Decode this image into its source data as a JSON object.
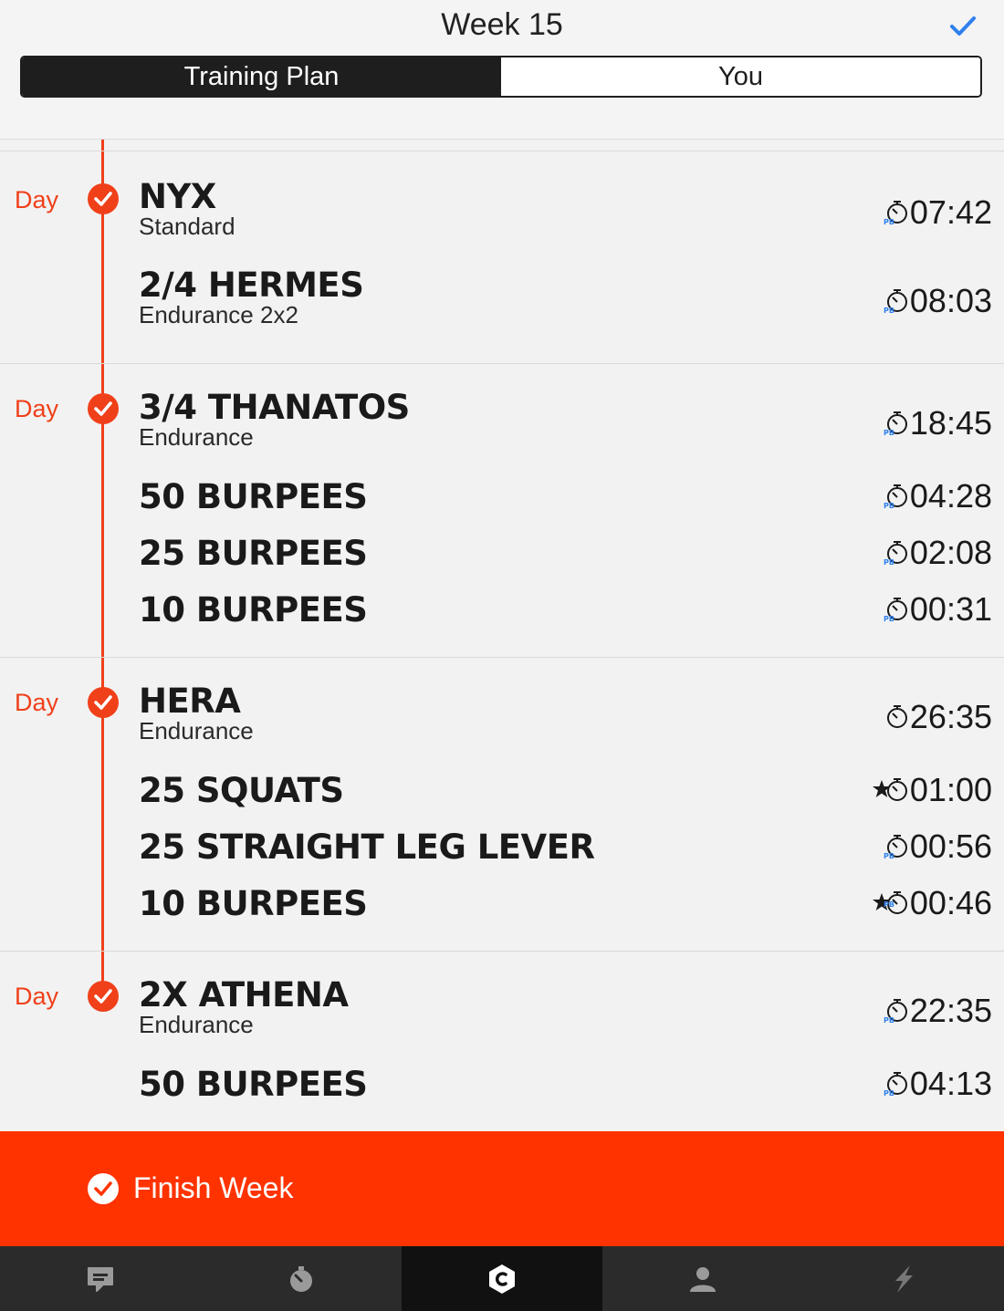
{
  "header": {
    "title": "Week 15",
    "segments": {
      "plan": "Training Plan",
      "you": "You"
    }
  },
  "days": [
    {
      "label": "Day",
      "workouts": [
        {
          "name": "NYX",
          "subtitle": "Standard",
          "time": "07:42",
          "icon": "stopwatch-pb-icon"
        },
        {
          "name": "2/4 HERMES",
          "subtitle": "Endurance 2x2",
          "time": "08:03",
          "icon": "stopwatch-pb-icon"
        }
      ]
    },
    {
      "label": "Day",
      "workouts": [
        {
          "name": "3/4 THANATOS",
          "subtitle": "Endurance",
          "time": "18:45",
          "icon": "stopwatch-pb-icon"
        },
        {
          "name": "50 BURPEES",
          "time": "04:28",
          "icon": "stopwatch-pb-icon"
        },
        {
          "name": "25 BURPEES",
          "time": "02:08",
          "icon": "stopwatch-pb-icon"
        },
        {
          "name": "10 BURPEES",
          "time": "00:31",
          "icon": "stopwatch-pb-icon"
        }
      ]
    },
    {
      "label": "Day",
      "workouts": [
        {
          "name": "HERA",
          "subtitle": "Endurance",
          "time": "26:35",
          "icon": "stopwatch-icon"
        },
        {
          "name": "25 SQUATS",
          "time": "01:00",
          "icon": "star-stopwatch-icon"
        },
        {
          "name": "25 STRAIGHT LEG LEVER",
          "time": "00:56",
          "icon": "stopwatch-pb-icon"
        },
        {
          "name": "10 BURPEES",
          "time": "00:46",
          "icon": "star-stopwatch-pb-icon"
        }
      ]
    },
    {
      "label": "Day",
      "workouts": [
        {
          "name": "2X ATHENA",
          "subtitle": "Endurance",
          "time": "22:35",
          "icon": "stopwatch-pb-icon"
        },
        {
          "name": "50 BURPEES",
          "time": "04:13",
          "icon": "stopwatch-pb-icon"
        }
      ]
    }
  ],
  "pb_badge": "PB",
  "finish_label": "Finish Week",
  "tabs": [
    {
      "icon": "chat-icon"
    },
    {
      "icon": "stopwatch-icon"
    },
    {
      "icon": "c-logo-icon"
    },
    {
      "icon": "profile-icon"
    },
    {
      "icon": "lightning-icon"
    }
  ],
  "colors": {
    "accent": "#f0401a",
    "finish_bg": "#ff3300",
    "check_blue": "#2f80ed",
    "tabbar": "#2b2b2b",
    "tab_active": "#111111"
  }
}
